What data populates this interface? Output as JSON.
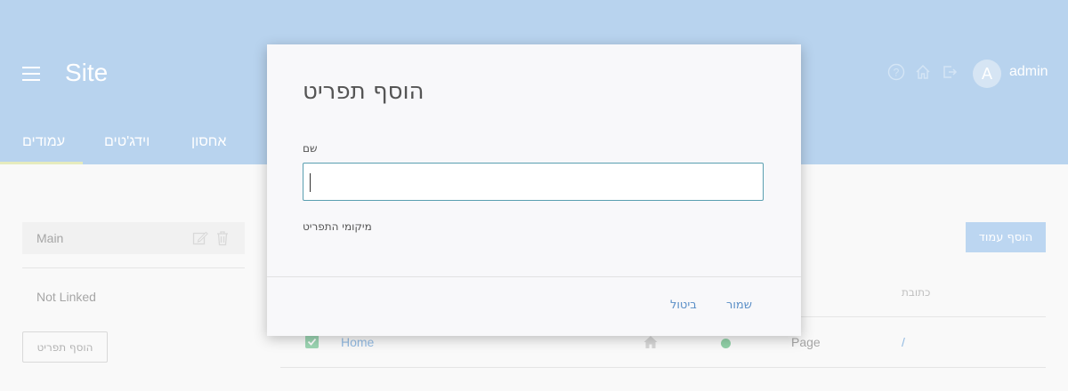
{
  "header": {
    "site_title": "Site",
    "username": "admin",
    "avatar_letter": "A",
    "tabs": [
      {
        "label": "עמודים"
      },
      {
        "label": "וידג'טים"
      },
      {
        "label": "אחסון"
      }
    ]
  },
  "sidebar": {
    "menu_name": "Main",
    "not_linked": "Not Linked",
    "add_menu_label": "הוסף תפריט"
  },
  "main": {
    "add_page_label": "הוסף עמוד",
    "col_url": "כתובת",
    "rows": [
      {
        "title": "Home",
        "type": "Page",
        "url": "/"
      }
    ]
  },
  "modal": {
    "title": "הוסף תפריט",
    "name_label": "שם",
    "name_value": "",
    "locations_label": "מיקומי התפריט",
    "save_label": "שמור",
    "cancel_label": "ביטול"
  },
  "colors": {
    "header_bg": "#a0c4e8",
    "accent_link": "#5b8fc7",
    "status_green": "#6cc08a"
  }
}
